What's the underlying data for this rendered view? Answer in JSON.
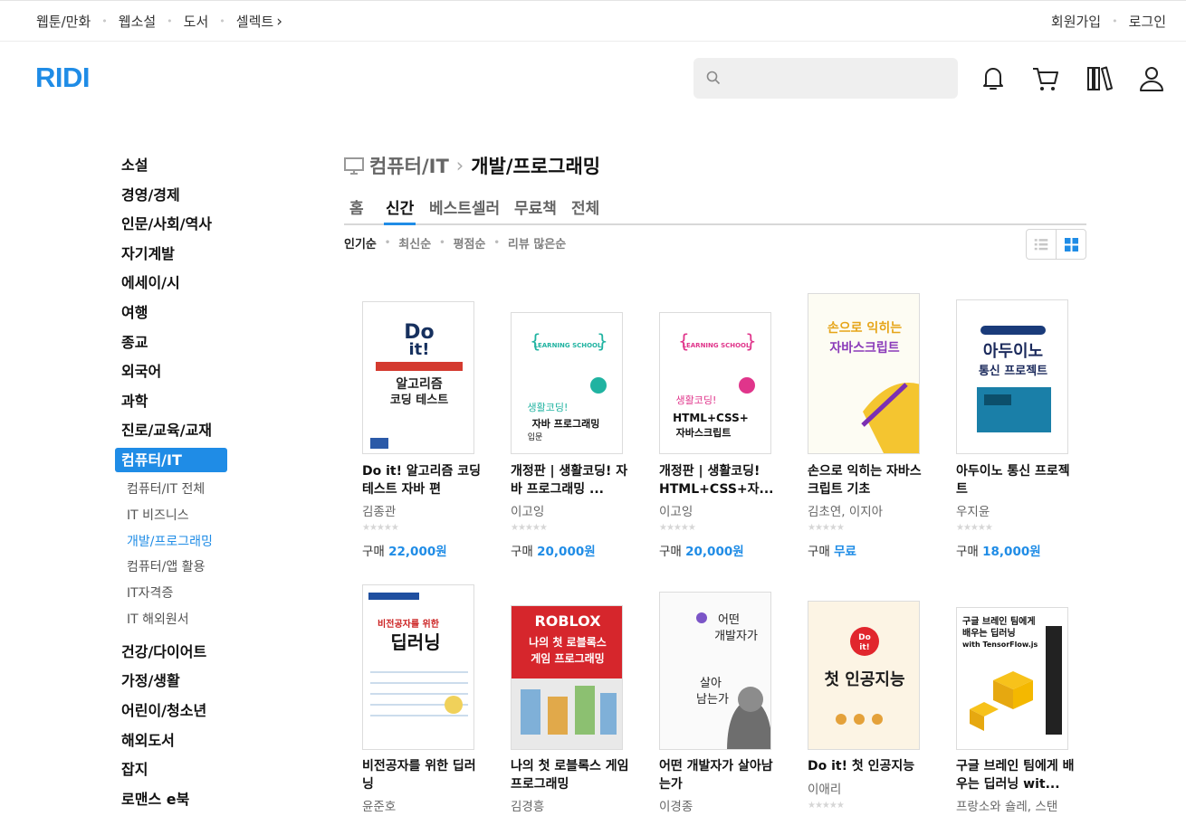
{
  "topbar": {
    "links": [
      "웹툰/만화",
      "웹소설",
      "도서",
      "셀렉트"
    ],
    "select_arrow": "›",
    "right": [
      "회원가입",
      "로그인"
    ]
  },
  "header": {
    "logo": "RIDI",
    "search_placeholder": "",
    "icons": [
      "bell-icon",
      "cart-icon",
      "library-icon",
      "user-icon"
    ]
  },
  "sidebar": {
    "categories_top": [
      "소설",
      "경영/경제",
      "인문/사회/역사",
      "자기계발",
      "에세이/시",
      "여행",
      "종교",
      "외국어",
      "과학",
      "진로/교육/교재"
    ],
    "active_category": "컴퓨터/IT",
    "subcategories": [
      "컴퓨터/IT 전체",
      "IT 비즈니스",
      "개발/프로그래밍",
      "컴퓨터/앱 활용",
      "IT자격증",
      "IT 해외원서"
    ],
    "current_sub": "개발/프로그래밍",
    "categories_bottom": [
      "건강/다이어트",
      "가정/생활",
      "어린이/청소년",
      "해외도서",
      "잡지",
      "로맨스 e북"
    ]
  },
  "breadcrumb": {
    "parent": "컴퓨터/IT",
    "current": "개발/프로그래밍"
  },
  "tabs": [
    "홈",
    "신간",
    "베스트셀러",
    "무료책",
    "전체"
  ],
  "active_tab": "신간",
  "sorts": [
    "인기순",
    "최신순",
    "평점순",
    "리뷰 많은순"
  ],
  "active_sort": "인기순",
  "price_prefix": "구매",
  "books": [
    {
      "title": "Do it! 알고리즘 코딩 테스트 자바 편",
      "author": "김종관",
      "price": "22,000원",
      "cover_text": "Do it! 알고리즘 코딩 테스트"
    },
    {
      "title": "개정판 | 생활코딩! 자바 프로그래밍 ...",
      "author": "이고잉",
      "price": "20,000원",
      "cover_text": "생활코딩! 자바 프로그래밍 입문"
    },
    {
      "title": "개정판 | 생활코딩! HTML+CSS+자...",
      "author": "이고잉",
      "price": "20,000원",
      "cover_text": "생활코딩! HTML+CSS+ 자바스크립트"
    },
    {
      "title": "손으로 익히는 자바스크립트 기초",
      "author": "김초연, 이지아",
      "price": "무료",
      "cover_text": "손으로 익히는 자바스크립트"
    },
    {
      "title": "아두이노 통신 프로젝트",
      "author": "우지윤",
      "price": "18,000원",
      "cover_text": "아두이노 통신 프로젝트"
    },
    {
      "title": "비전공자를 위한 딥러닝",
      "author": "윤준호",
      "price": "",
      "cover_text": "비전공자를 위한 딥러닝"
    },
    {
      "title": "나의 첫 로블록스 게임 프로그래밍",
      "author": "김경흥",
      "price": "",
      "cover_text": "ROBLOX 나의 첫 로블록스 게임 프로그래밍"
    },
    {
      "title": "어떤 개발자가 살아남는가",
      "author": "이경종",
      "price": "",
      "cover_text": "어떤 개발자가 살아 남는가"
    },
    {
      "title": "Do it! 첫 인공지능",
      "author": "이애리",
      "price": "",
      "cover_text": "Do it! 첫 인공지능"
    },
    {
      "title": "구글 브레인 팀에게 배우는 딥러닝 wit...",
      "author": "프랑소와 숄레, 스탠",
      "price": "",
      "cover_text": "구글 브레인 팀에게 배우는 딥러닝 with TensorFlow.js"
    }
  ],
  "colors": {
    "accent": "#1f8ce6"
  }
}
